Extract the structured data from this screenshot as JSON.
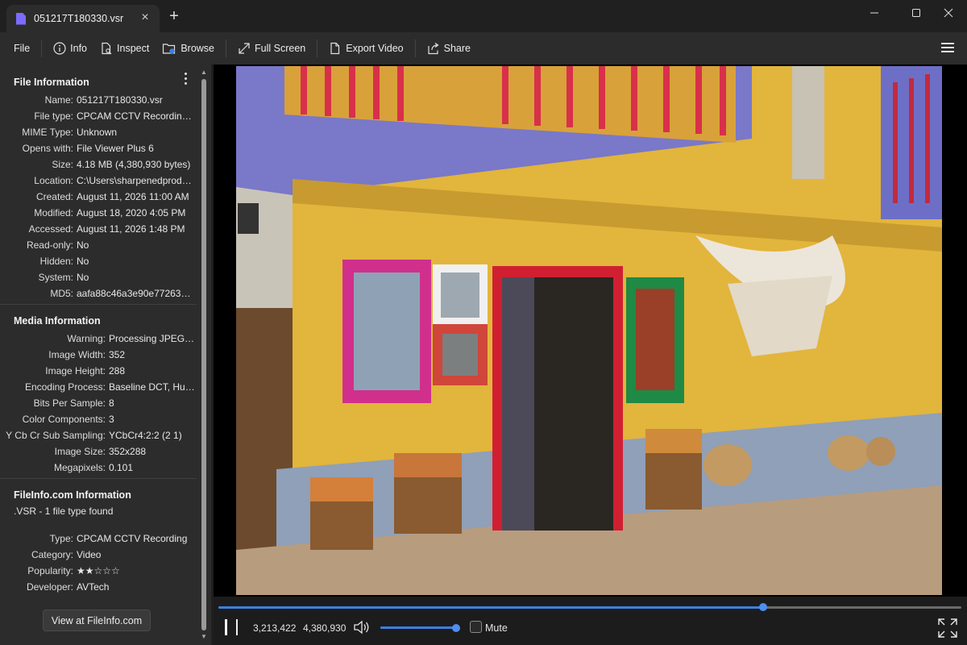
{
  "window": {
    "tab_title": "051217T180330.vsr",
    "new_tab_symbol": "+",
    "close_symbol": "×"
  },
  "toolbar": {
    "file": "File",
    "info": "Info",
    "inspect": "Inspect",
    "browse": "Browse",
    "full_screen": "Full Screen",
    "export_video": "Export Video",
    "share": "Share"
  },
  "file_info": {
    "title": "File Information",
    "rows": [
      {
        "k": "Name:",
        "v": "051217T180330.vsr"
      },
      {
        "k": "File type:",
        "v": "CPCAM CCTV Recording ..."
      },
      {
        "k": "MIME Type:",
        "v": "Unknown"
      },
      {
        "k": "Opens with:",
        "v": "File Viewer Plus 6"
      },
      {
        "k": "Size:",
        "v": "4.18 MB (4,380,930 bytes)"
      },
      {
        "k": "Location:",
        "v": "C:\\Users\\sharpenedprodu..."
      },
      {
        "k": "Created:",
        "v": "August 11, 2026 11:00 AM"
      },
      {
        "k": "Modified:",
        "v": "August 18, 2020 4:05 PM"
      },
      {
        "k": "Accessed:",
        "v": "August 11, 2026 1:48 PM"
      },
      {
        "k": "Read-only:",
        "v": "No"
      },
      {
        "k": "Hidden:",
        "v": "No"
      },
      {
        "k": "System:",
        "v": "No"
      },
      {
        "k": "MD5:",
        "v": "aafa88c46a3e90e77263866..."
      }
    ]
  },
  "media_info": {
    "title": "Media Information",
    "rows": [
      {
        "k": "Warning:",
        "v": "Processing JPEG-li..."
      },
      {
        "k": "Image Width:",
        "v": "352"
      },
      {
        "k": "Image Height:",
        "v": "288"
      },
      {
        "k": "Encoding Process:",
        "v": "Baseline DCT, Huf..."
      },
      {
        "k": "Bits Per Sample:",
        "v": "8"
      },
      {
        "k": "Color Components:",
        "v": "3"
      },
      {
        "k": "Y Cb Cr Sub Sampling:",
        "v": "YCbCr4:2:2 (2 1)"
      },
      {
        "k": "Image Size:",
        "v": "352x288"
      },
      {
        "k": "Megapixels:",
        "v": "0.101"
      }
    ]
  },
  "fileinfo": {
    "title": "FileInfo.com Information",
    "found": ".VSR - 1 file type found",
    "rows": [
      {
        "k": "Type:",
        "v": "CPCAM CCTV Recording"
      },
      {
        "k": "Category:",
        "v": "Video"
      },
      {
        "k": "Popularity:",
        "v": "★★☆☆☆"
      },
      {
        "k": "Developer:",
        "v": "AVTech"
      }
    ],
    "button": "View at FileInfo.com"
  },
  "player": {
    "position": "3,213,422",
    "total": "4,380,930",
    "seek_fraction": 0.7335,
    "volume_fraction": 1.0,
    "mute_label": "Mute",
    "mute_checked": false
  },
  "colors": {
    "accent": "#3d7fe0",
    "tab_icon": "#7b6cff"
  }
}
